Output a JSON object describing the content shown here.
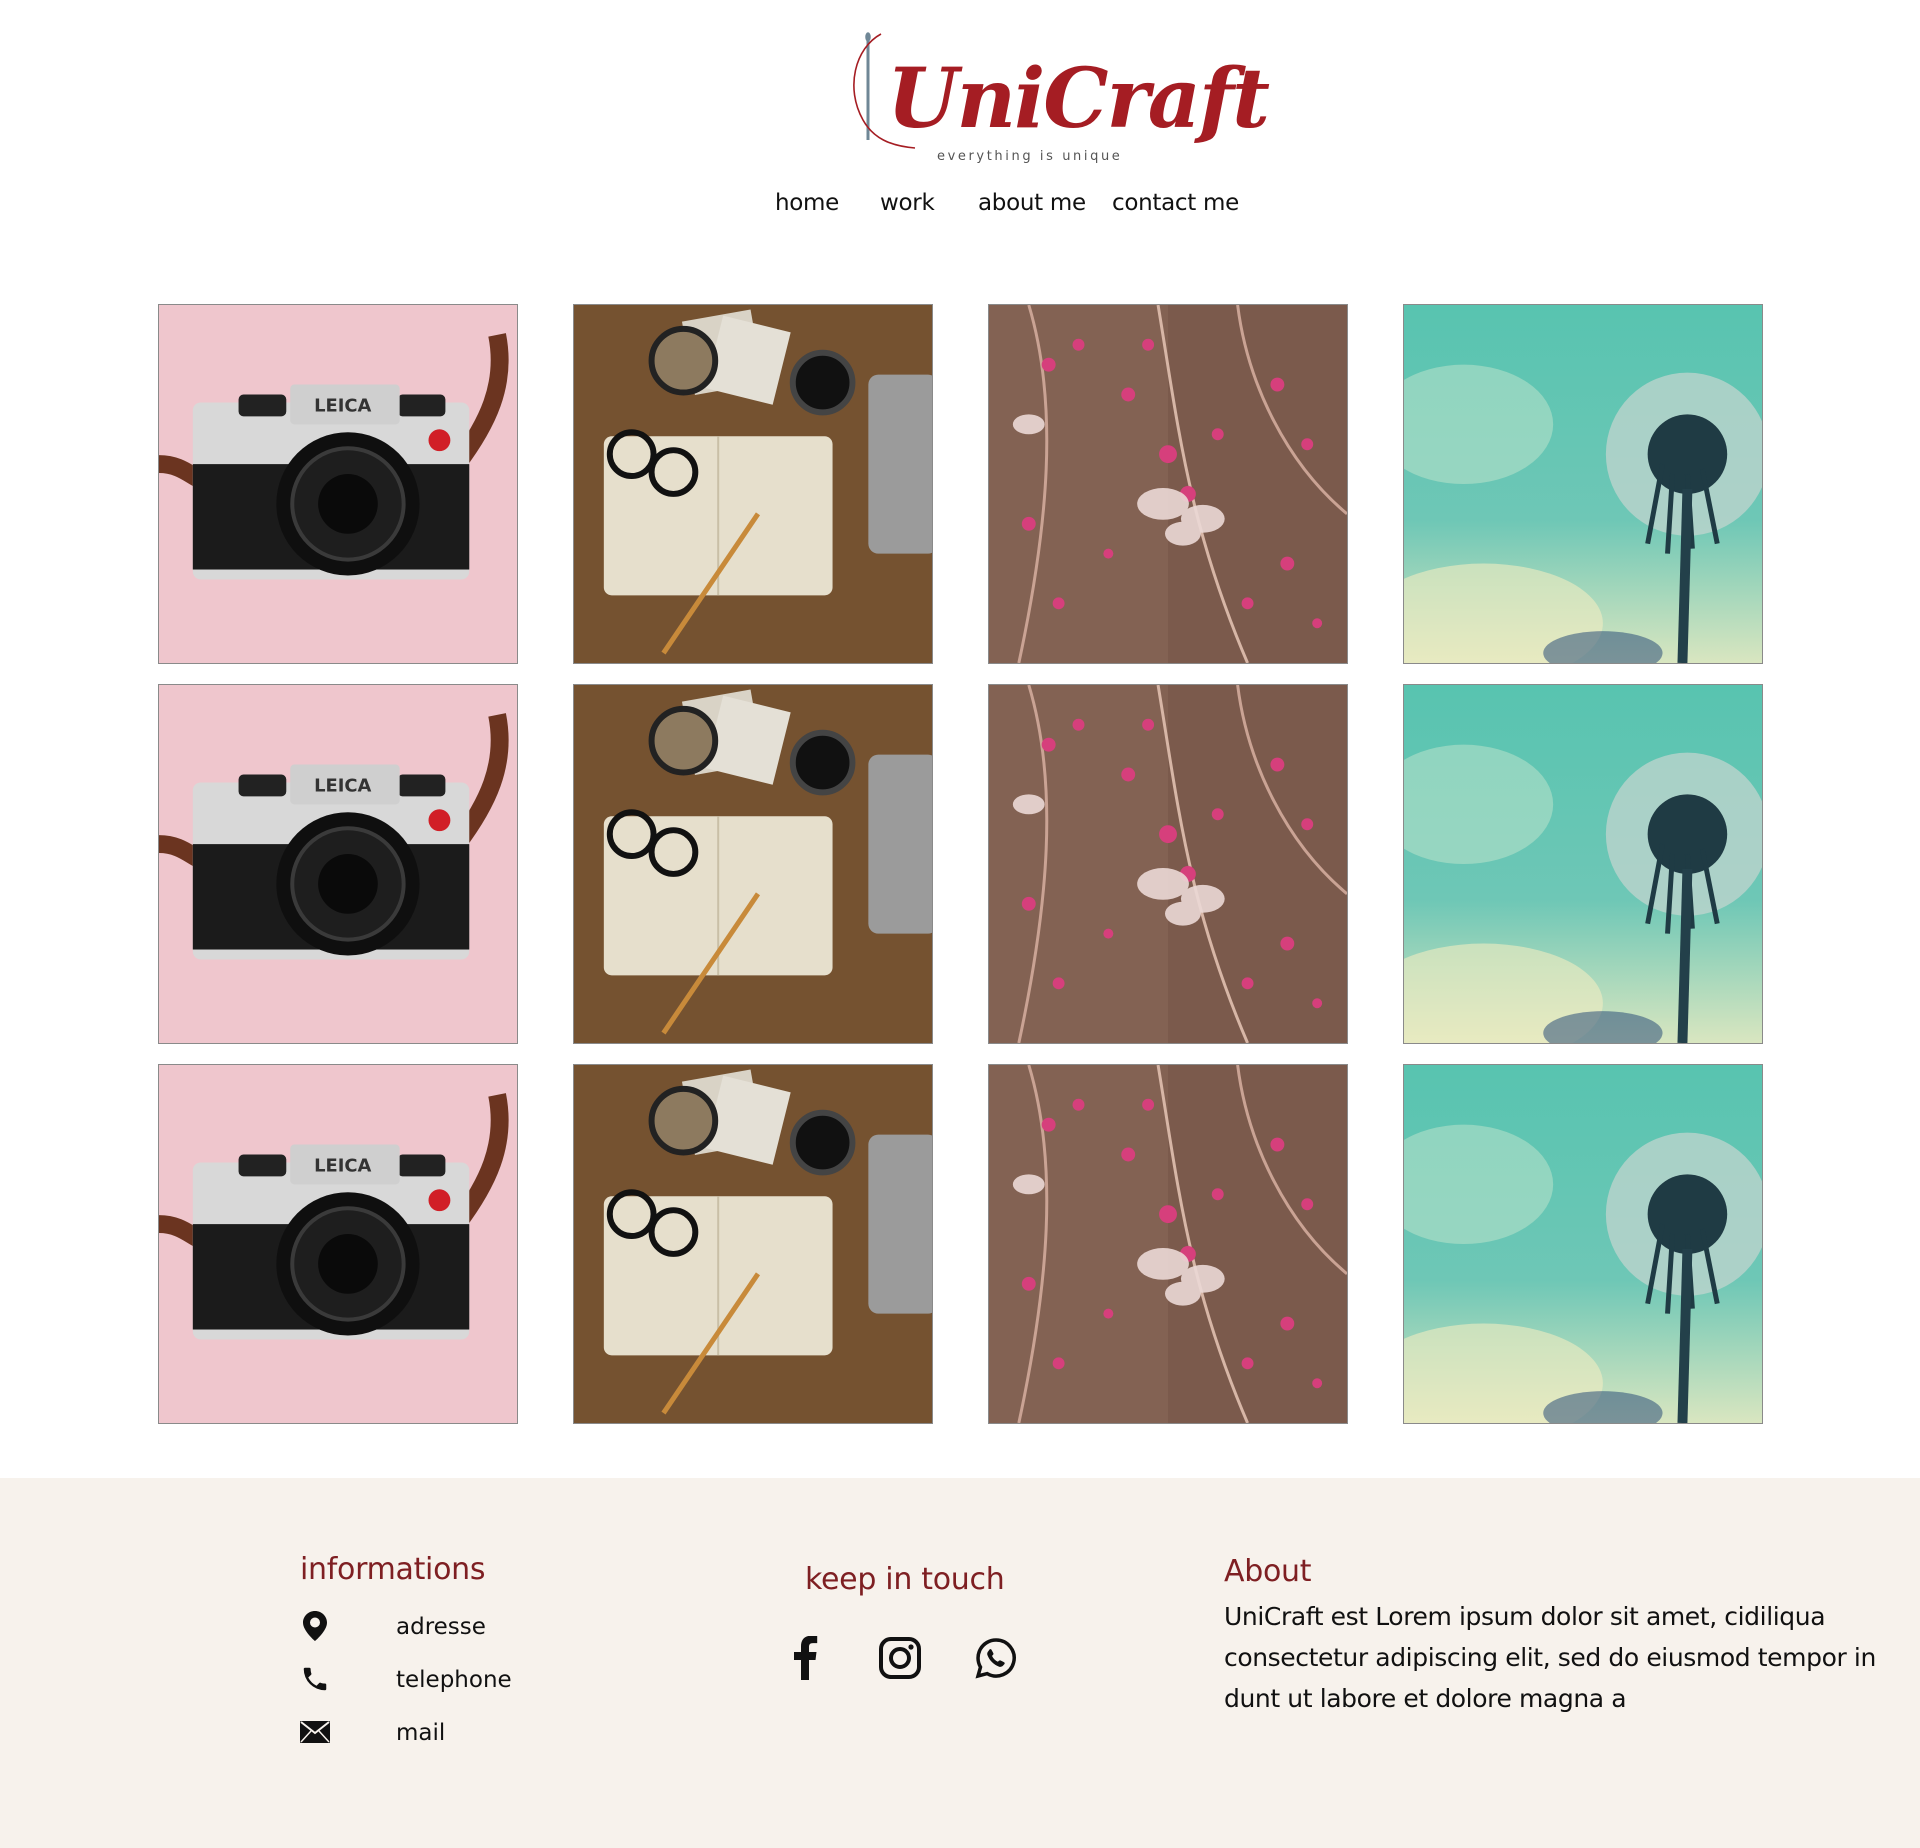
{
  "brand": {
    "name": "UniCraft",
    "tagline": "everything is unique",
    "color": "#a51d23"
  },
  "nav": {
    "items": [
      {
        "label": "home"
      },
      {
        "label": "work"
      },
      {
        "label": "about me"
      },
      {
        "label": "contact me"
      }
    ]
  },
  "gallery": {
    "photos": [
      "camera-photo",
      "desk-flatlay-photo",
      "pink-blossom-photo",
      "dandelion-photo"
    ],
    "rows": 3,
    "columns": 4
  },
  "footer": {
    "background": "#f7f2ec",
    "heading_color": "#7e1f22",
    "informations": {
      "title": "informations",
      "items": [
        {
          "icon": "location-pin-icon",
          "label": "adresse"
        },
        {
          "icon": "phone-icon",
          "label": "telephone"
        },
        {
          "icon": "mail-icon",
          "label": "mail"
        }
      ]
    },
    "keep_in_touch": {
      "title": "keep in touch",
      "icons": [
        "facebook-icon",
        "instagram-icon",
        "whatsapp-icon"
      ]
    },
    "about": {
      "title": "About",
      "text": "UniCraft est Lorem ipsum dolor sit amet, cidiliqua consectetur adipiscing elit, sed do eiusmod tempor in dunt ut labore et dolore magna a"
    }
  }
}
